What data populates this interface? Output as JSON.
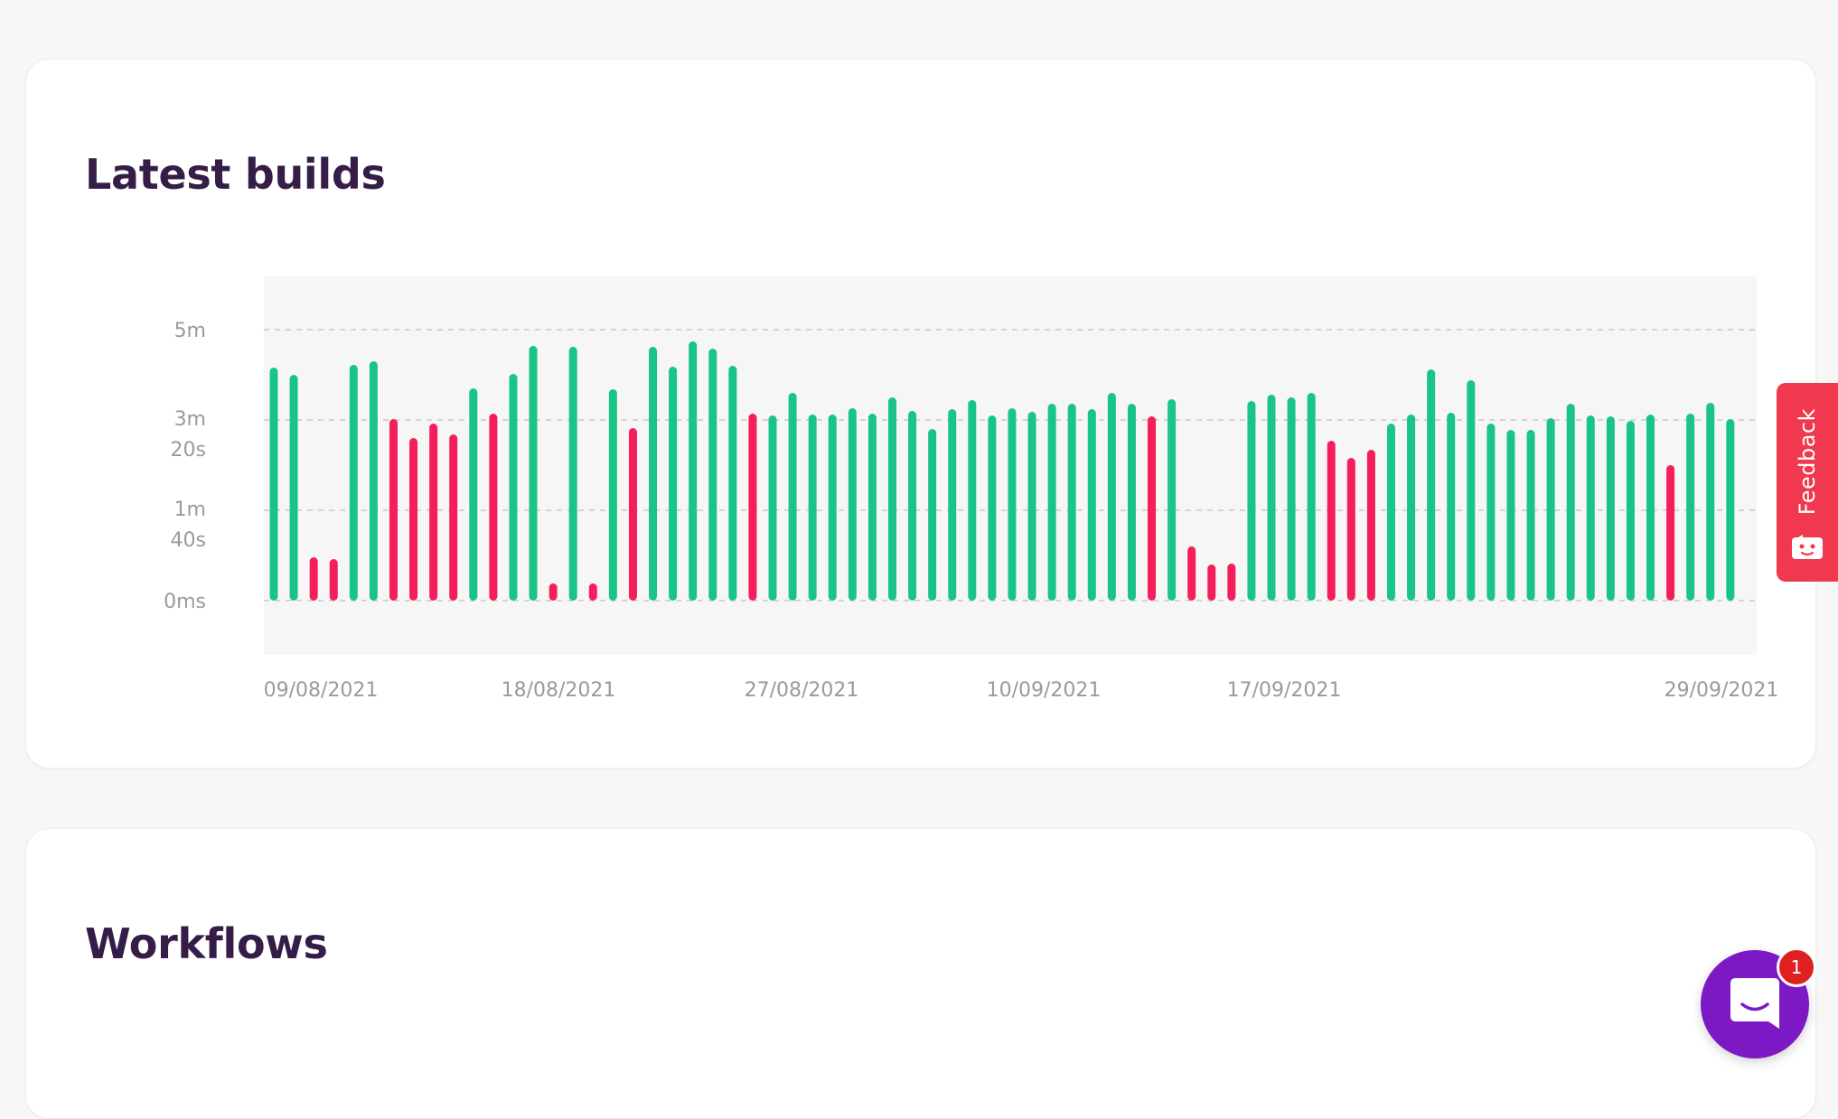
{
  "builds_card": {
    "title": "Latest builds"
  },
  "workflows_card": {
    "title": "Workflows"
  },
  "feedback": {
    "label": "Feedback",
    "icon": "feedback-face-icon"
  },
  "chat": {
    "badge_count": "1",
    "icon": "chat-bubble-icon"
  },
  "colors": {
    "success": "#19c586",
    "failed": "#f41e5a",
    "title": "#351d48",
    "chat": "#7c19c4",
    "feedback": "#f0384f"
  },
  "chart_data": {
    "type": "bar",
    "title": "",
    "y_ticks": [
      {
        "label": "0ms",
        "seconds": 0
      },
      {
        "label": "1m\n40s",
        "seconds": 100
      },
      {
        "label": "3m\n20s",
        "seconds": 200
      },
      {
        "label": "5m",
        "seconds": 300
      }
    ],
    "x_tick_labels": [
      "09/08/2021",
      "18/08/2021",
      "27/08/2021",
      "10/09/2021",
      "17/09/2021",
      "29/09/2021"
    ],
    "ylim_seconds": [
      0,
      300
    ],
    "grid": true,
    "series": [
      {
        "name": "success",
        "color": "#19c586"
      },
      {
        "name": "failed",
        "color": "#f41e5a"
      }
    ],
    "builds": [
      {
        "status": "success",
        "seconds": 258
      },
      {
        "status": "success",
        "seconds": 250
      },
      {
        "status": "failed",
        "seconds": 48
      },
      {
        "status": "failed",
        "seconds": 46
      },
      {
        "status": "success",
        "seconds": 261
      },
      {
        "status": "success",
        "seconds": 265
      },
      {
        "status": "failed",
        "seconds": 201
      },
      {
        "status": "failed",
        "seconds": 180
      },
      {
        "status": "failed",
        "seconds": 196
      },
      {
        "status": "failed",
        "seconds": 184
      },
      {
        "status": "success",
        "seconds": 235
      },
      {
        "status": "failed",
        "seconds": 207
      },
      {
        "status": "success",
        "seconds": 251
      },
      {
        "status": "success",
        "seconds": 282
      },
      {
        "status": "failed",
        "seconds": 19
      },
      {
        "status": "success",
        "seconds": 281
      },
      {
        "status": "failed",
        "seconds": 19
      },
      {
        "status": "success",
        "seconds": 234
      },
      {
        "status": "failed",
        "seconds": 191
      },
      {
        "status": "success",
        "seconds": 281
      },
      {
        "status": "success",
        "seconds": 259
      },
      {
        "status": "success",
        "seconds": 287
      },
      {
        "status": "success",
        "seconds": 279
      },
      {
        "status": "success",
        "seconds": 260
      },
      {
        "status": "failed",
        "seconds": 207
      },
      {
        "status": "success",
        "seconds": 205
      },
      {
        "status": "success",
        "seconds": 230
      },
      {
        "status": "success",
        "seconds": 206
      },
      {
        "status": "success",
        "seconds": 206
      },
      {
        "status": "success",
        "seconds": 213
      },
      {
        "status": "success",
        "seconds": 207
      },
      {
        "status": "success",
        "seconds": 225
      },
      {
        "status": "success",
        "seconds": 210
      },
      {
        "status": "success",
        "seconds": 190
      },
      {
        "status": "success",
        "seconds": 212
      },
      {
        "status": "success",
        "seconds": 222
      },
      {
        "status": "success",
        "seconds": 205
      },
      {
        "status": "success",
        "seconds": 213
      },
      {
        "status": "success",
        "seconds": 209
      },
      {
        "status": "success",
        "seconds": 218
      },
      {
        "status": "success",
        "seconds": 218
      },
      {
        "status": "success",
        "seconds": 212
      },
      {
        "status": "success",
        "seconds": 230
      },
      {
        "status": "success",
        "seconds": 218
      },
      {
        "status": "failed",
        "seconds": 204
      },
      {
        "status": "success",
        "seconds": 223
      },
      {
        "status": "failed",
        "seconds": 60
      },
      {
        "status": "failed",
        "seconds": 40
      },
      {
        "status": "failed",
        "seconds": 41
      },
      {
        "status": "success",
        "seconds": 221
      },
      {
        "status": "success",
        "seconds": 228
      },
      {
        "status": "success",
        "seconds": 225
      },
      {
        "status": "success",
        "seconds": 230
      },
      {
        "status": "failed",
        "seconds": 177
      },
      {
        "status": "failed",
        "seconds": 158
      },
      {
        "status": "failed",
        "seconds": 167
      },
      {
        "status": "success",
        "seconds": 196
      },
      {
        "status": "success",
        "seconds": 206
      },
      {
        "status": "success",
        "seconds": 256
      },
      {
        "status": "success",
        "seconds": 208
      },
      {
        "status": "success",
        "seconds": 244
      },
      {
        "status": "success",
        "seconds": 196
      },
      {
        "status": "success",
        "seconds": 189
      },
      {
        "status": "success",
        "seconds": 189
      },
      {
        "status": "success",
        "seconds": 202
      },
      {
        "status": "success",
        "seconds": 218
      },
      {
        "status": "success",
        "seconds": 205
      },
      {
        "status": "success",
        "seconds": 204
      },
      {
        "status": "success",
        "seconds": 199
      },
      {
        "status": "success",
        "seconds": 206
      },
      {
        "status": "failed",
        "seconds": 150
      },
      {
        "status": "success",
        "seconds": 207
      },
      {
        "status": "success",
        "seconds": 219
      },
      {
        "status": "success",
        "seconds": 201
      }
    ]
  }
}
